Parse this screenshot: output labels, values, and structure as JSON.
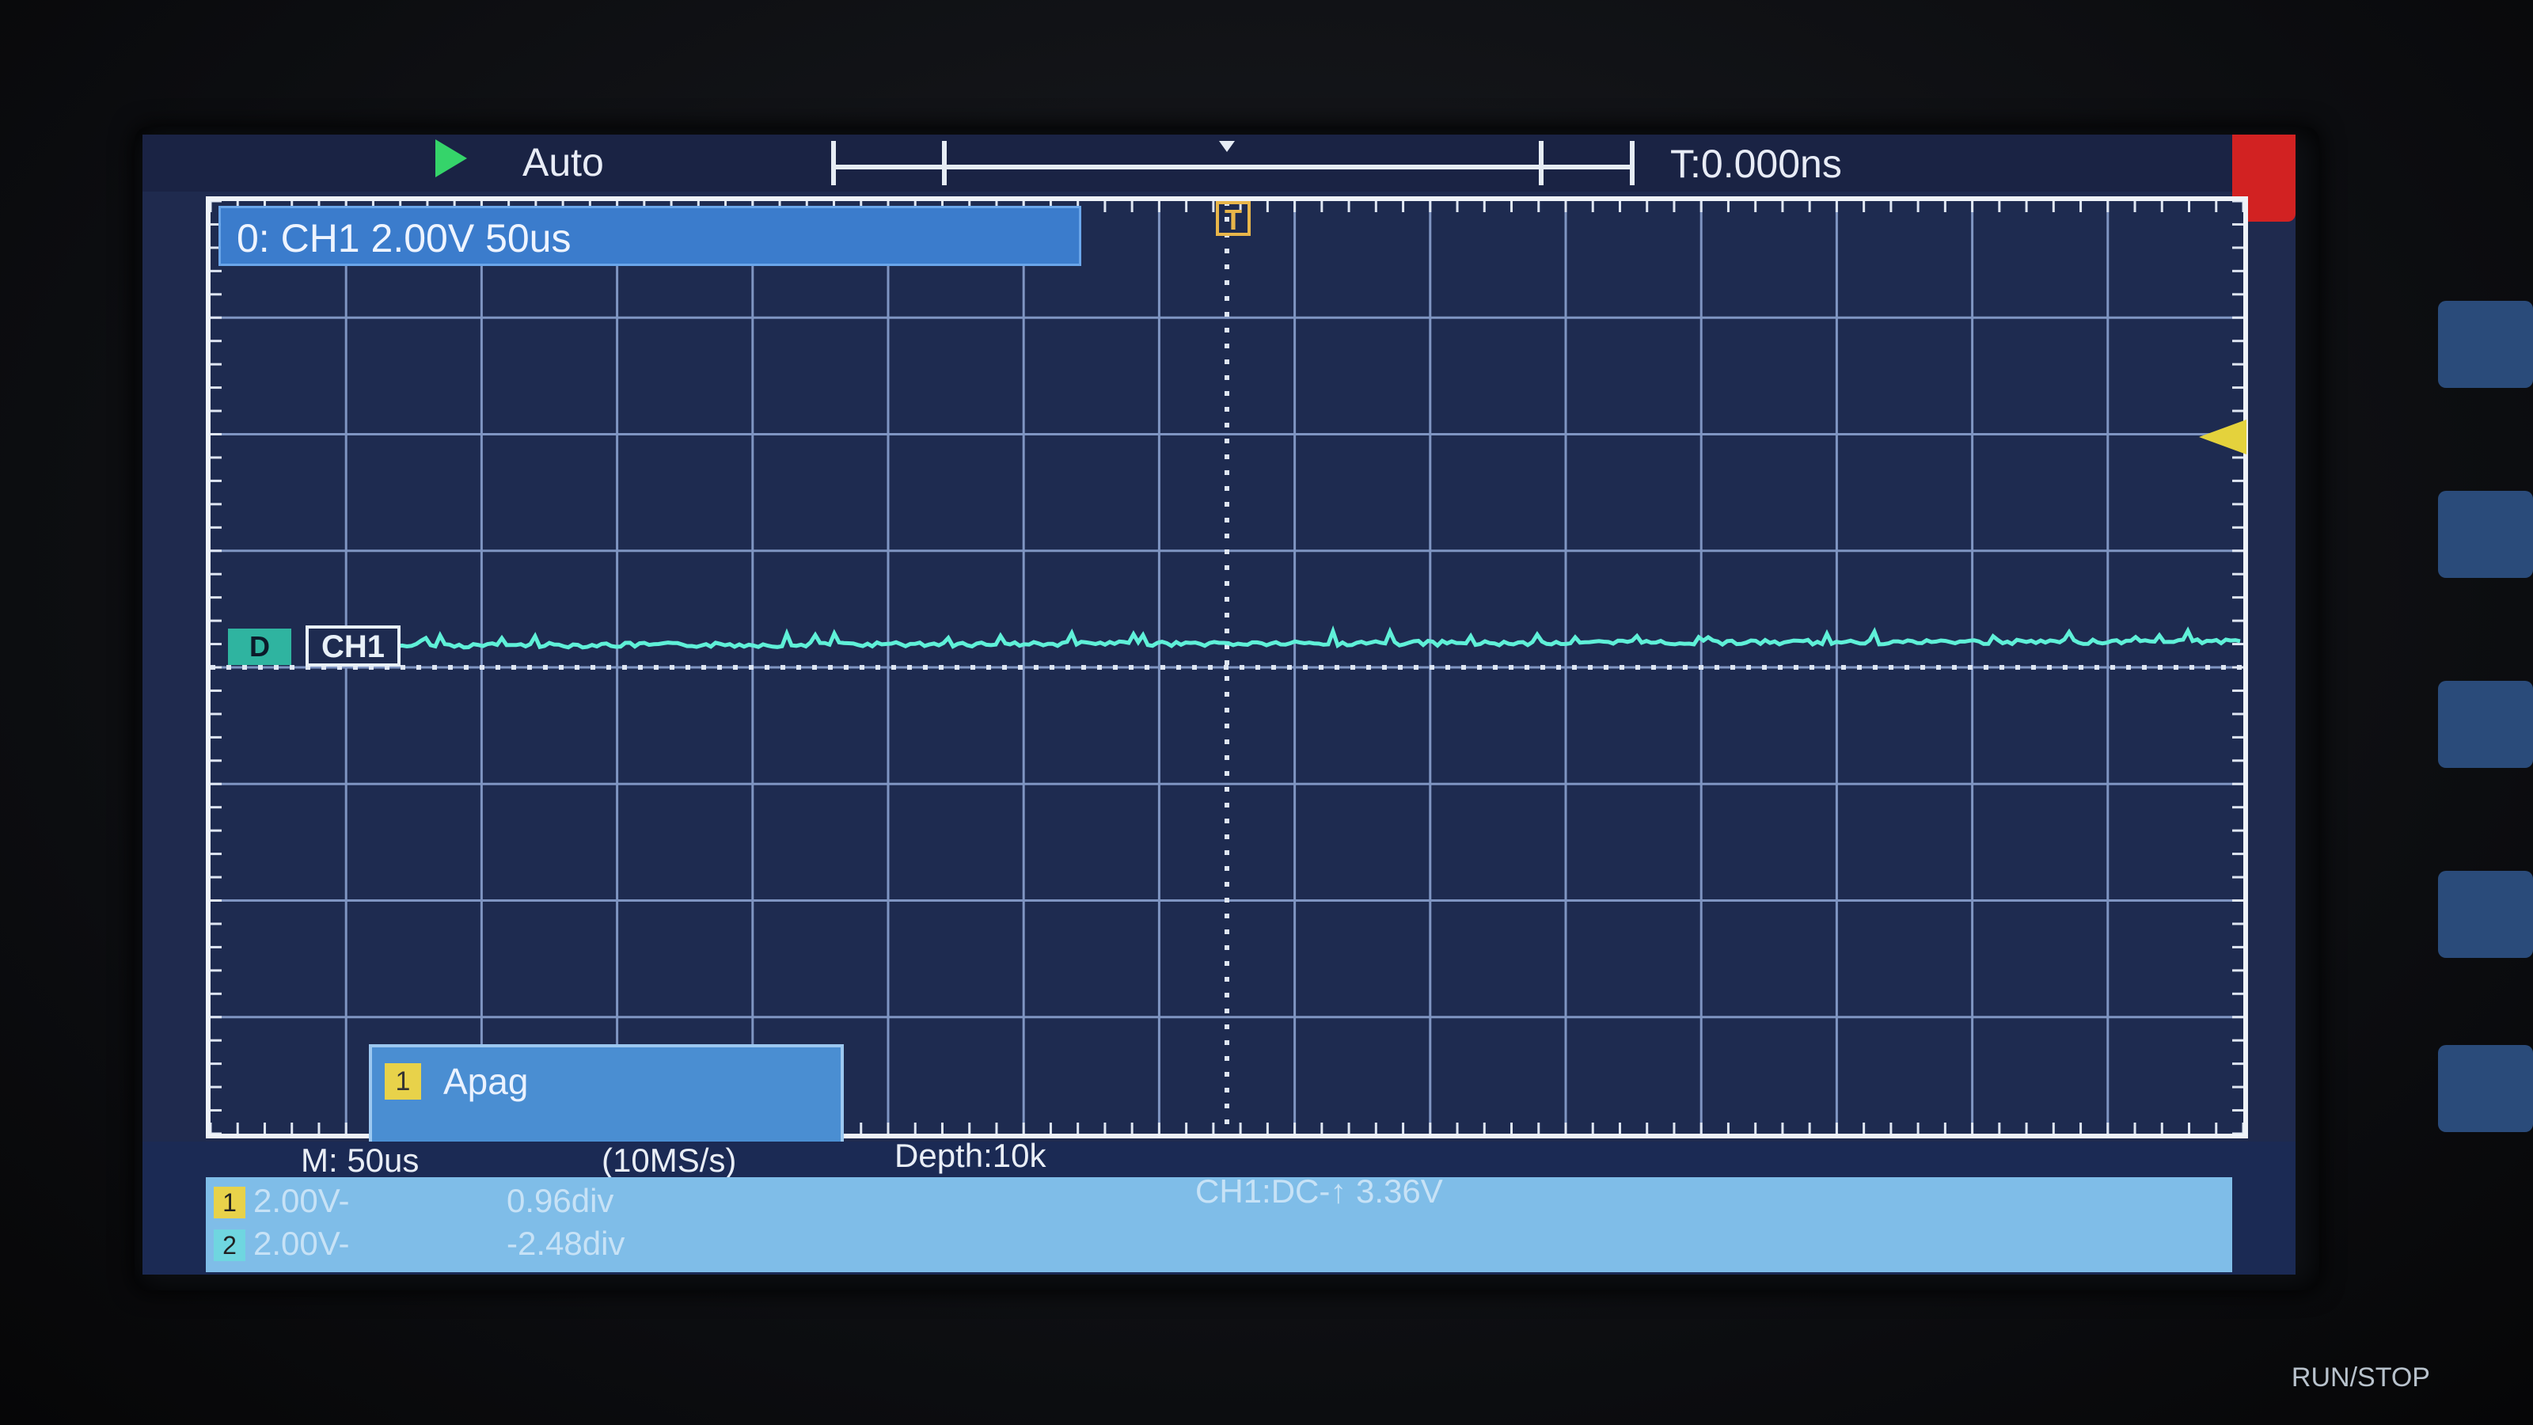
{
  "topbar": {
    "trigger_mode": "Auto",
    "trigger_delay": "T:0.000ns"
  },
  "info": {
    "channel_summary": "0: CH1 2.00V 50us",
    "trigger_marker": "T",
    "ground_tag": "D",
    "ch1_label": "CH1"
  },
  "menu": {
    "number": "1",
    "label": "Apag"
  },
  "status": {
    "timebase": "M: 50us",
    "sample_rate": "(10MS/s)",
    "depth": "Depth:10k",
    "trigger_info": "CH1:DC-↑ 3.36V",
    "ch1": {
      "num": "1",
      "scale": "2.00V-",
      "offset": "0.96div"
    },
    "ch2": {
      "num": "2",
      "scale": "2.00V-",
      "offset": "-2.48div"
    }
  },
  "panel": {
    "run_stop": "RUN/STOP"
  },
  "colors": {
    "screen_bg": "#1f2a4e",
    "trace": "#5ff0d8",
    "grid": "#7f95c2",
    "trigger_marker": "#e8b64a",
    "trigger_level": "#e4d23c",
    "run_indicator": "#35d46a"
  }
}
